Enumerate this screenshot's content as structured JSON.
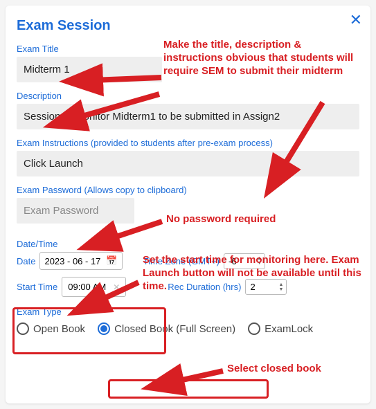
{
  "dialog": {
    "title": "Exam Session",
    "close_glyph": "✕"
  },
  "fields": {
    "exam_title": {
      "label": "Exam Title",
      "value": "Midterm 1"
    },
    "description": {
      "label": "Description",
      "value": "Session to monitor Midterm1 to be submitted in Assign2"
    },
    "instructions": {
      "label": "Exam Instructions (provided to students after pre-exam process)",
      "value": "Click Launch"
    },
    "password": {
      "label": "Exam Password (Allows copy to clipboard)",
      "placeholder": "Exam Password",
      "value": ""
    },
    "datetime_label": "Date/Time",
    "date": {
      "label": "Date",
      "value": "2023 - 06 - 17"
    },
    "timezone": {
      "label": "Time Zone (GMT+)",
      "value": "-6"
    },
    "start_time": {
      "label": "Start Time",
      "value": "09:00 AM"
    },
    "rec_duration": {
      "label": "Rec Duration (hrs)",
      "value": "2"
    },
    "exam_type": {
      "label": "Exam Type",
      "options": [
        "Open Book",
        "Closed Book (Full Screen)",
        "ExamLock"
      ],
      "selected": 1
    }
  },
  "annotations": {
    "a1": "Make the title, description & instructions obvious that students will require SEM to submit their midterm",
    "a2": "No password required",
    "a3": "Set the start time for monitoring here. Exam Launch button will not be available until this time.",
    "a4": "Select closed book"
  }
}
